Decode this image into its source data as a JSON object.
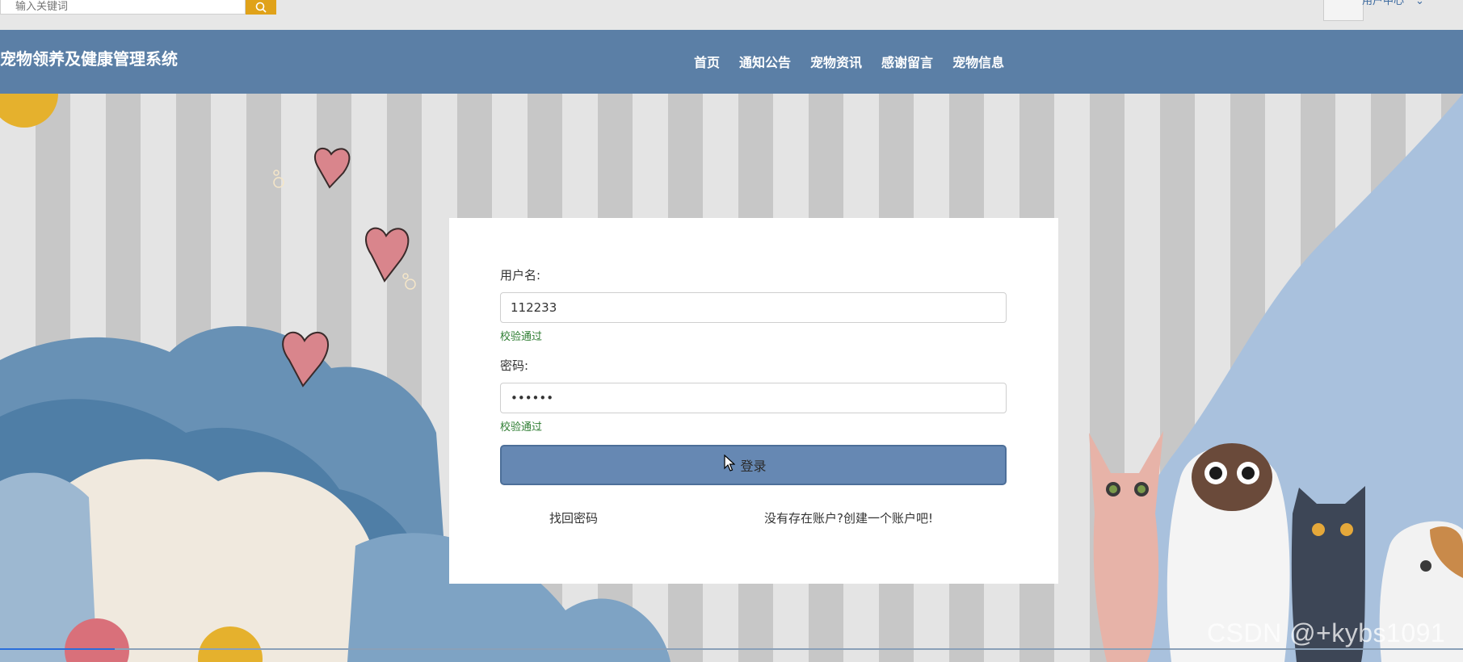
{
  "search": {
    "placeholder": "输入关键词",
    "value": "输入关键词"
  },
  "user_menu": {
    "label": "用户中心",
    "chevron": "⌄"
  },
  "header": {
    "title": "宠物领养及健康管理系统",
    "nav": [
      "首页",
      "通知公告",
      "宠物资讯",
      "感谢留言",
      "宠物信息"
    ]
  },
  "login": {
    "username_label": "用户名:",
    "username_value": "112233",
    "username_status": "校验通过",
    "password_label": "密码:",
    "password_value": "123456",
    "password_status": "校验通过",
    "submit_label": "登录",
    "forgot_link": "找回密码",
    "register_link": "没有存在账户?创建一个账户吧!"
  },
  "watermark": "CSDN @+kybs1091",
  "colors": {
    "header": "#5b7fa6",
    "button": "#6688b3",
    "search_button": "#e0a21a",
    "ok_text": "#2e7d32"
  },
  "icons": {
    "search": "search-icon",
    "cursor": "mouse-cursor-icon"
  }
}
